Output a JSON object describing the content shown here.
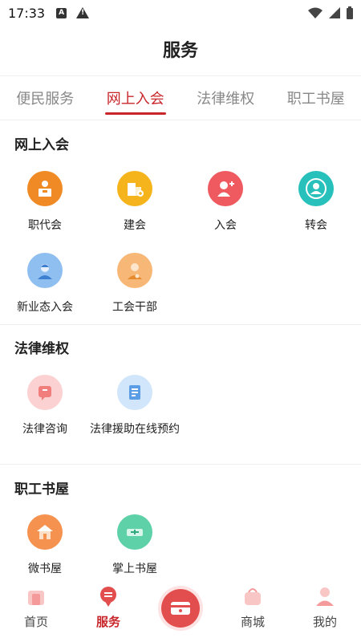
{
  "status": {
    "time": "17:33"
  },
  "header": {
    "title": "服务"
  },
  "tabs": [
    {
      "label": "便民服务",
      "active": false
    },
    {
      "label": "网上入会",
      "active": true
    },
    {
      "label": "法律维权",
      "active": false
    },
    {
      "label": "职工书屋",
      "active": false
    }
  ],
  "sections": [
    {
      "title": "网上入会",
      "items": [
        {
          "label": "职代会",
          "icon": "rostrum-icon",
          "color": "#f08a24"
        },
        {
          "label": "建会",
          "icon": "building-icon",
          "color": "#f5b41b"
        },
        {
          "label": "入会",
          "icon": "add-person-icon",
          "color": "#ee5a5f"
        },
        {
          "label": "转会",
          "icon": "transfer-person-icon",
          "color": "#27c0bb"
        },
        {
          "label": "新业态入会",
          "icon": "worker-icon",
          "color": "#8fbff0"
        },
        {
          "label": "工会干部",
          "icon": "cadre-icon",
          "color": "#f7b877"
        }
      ]
    },
    {
      "title": "法律维权",
      "items": [
        {
          "label": "法律咨询",
          "icon": "consult-icon",
          "color": "#f79a9a"
        },
        {
          "label": "法律援助在线预约",
          "icon": "document-icon",
          "color": "#8fbef0"
        }
      ]
    },
    {
      "title": "职工书屋",
      "items": [
        {
          "label": "微书屋",
          "icon": "house-icon",
          "color": "#f5924f"
        },
        {
          "label": "掌上书屋",
          "icon": "book-icon",
          "color": "#5fd1a8"
        }
      ]
    }
  ],
  "bottom_nav": [
    {
      "label": "首页",
      "icon": "home-icon",
      "active": false
    },
    {
      "label": "服务",
      "icon": "service-icon",
      "active": true
    },
    {
      "label": "",
      "icon": "card-icon",
      "active": false
    },
    {
      "label": "商城",
      "icon": "shop-bag-icon",
      "active": false
    },
    {
      "label": "我的",
      "icon": "profile-icon",
      "active": false
    }
  ],
  "colors": {
    "accent": "#c8262b"
  }
}
